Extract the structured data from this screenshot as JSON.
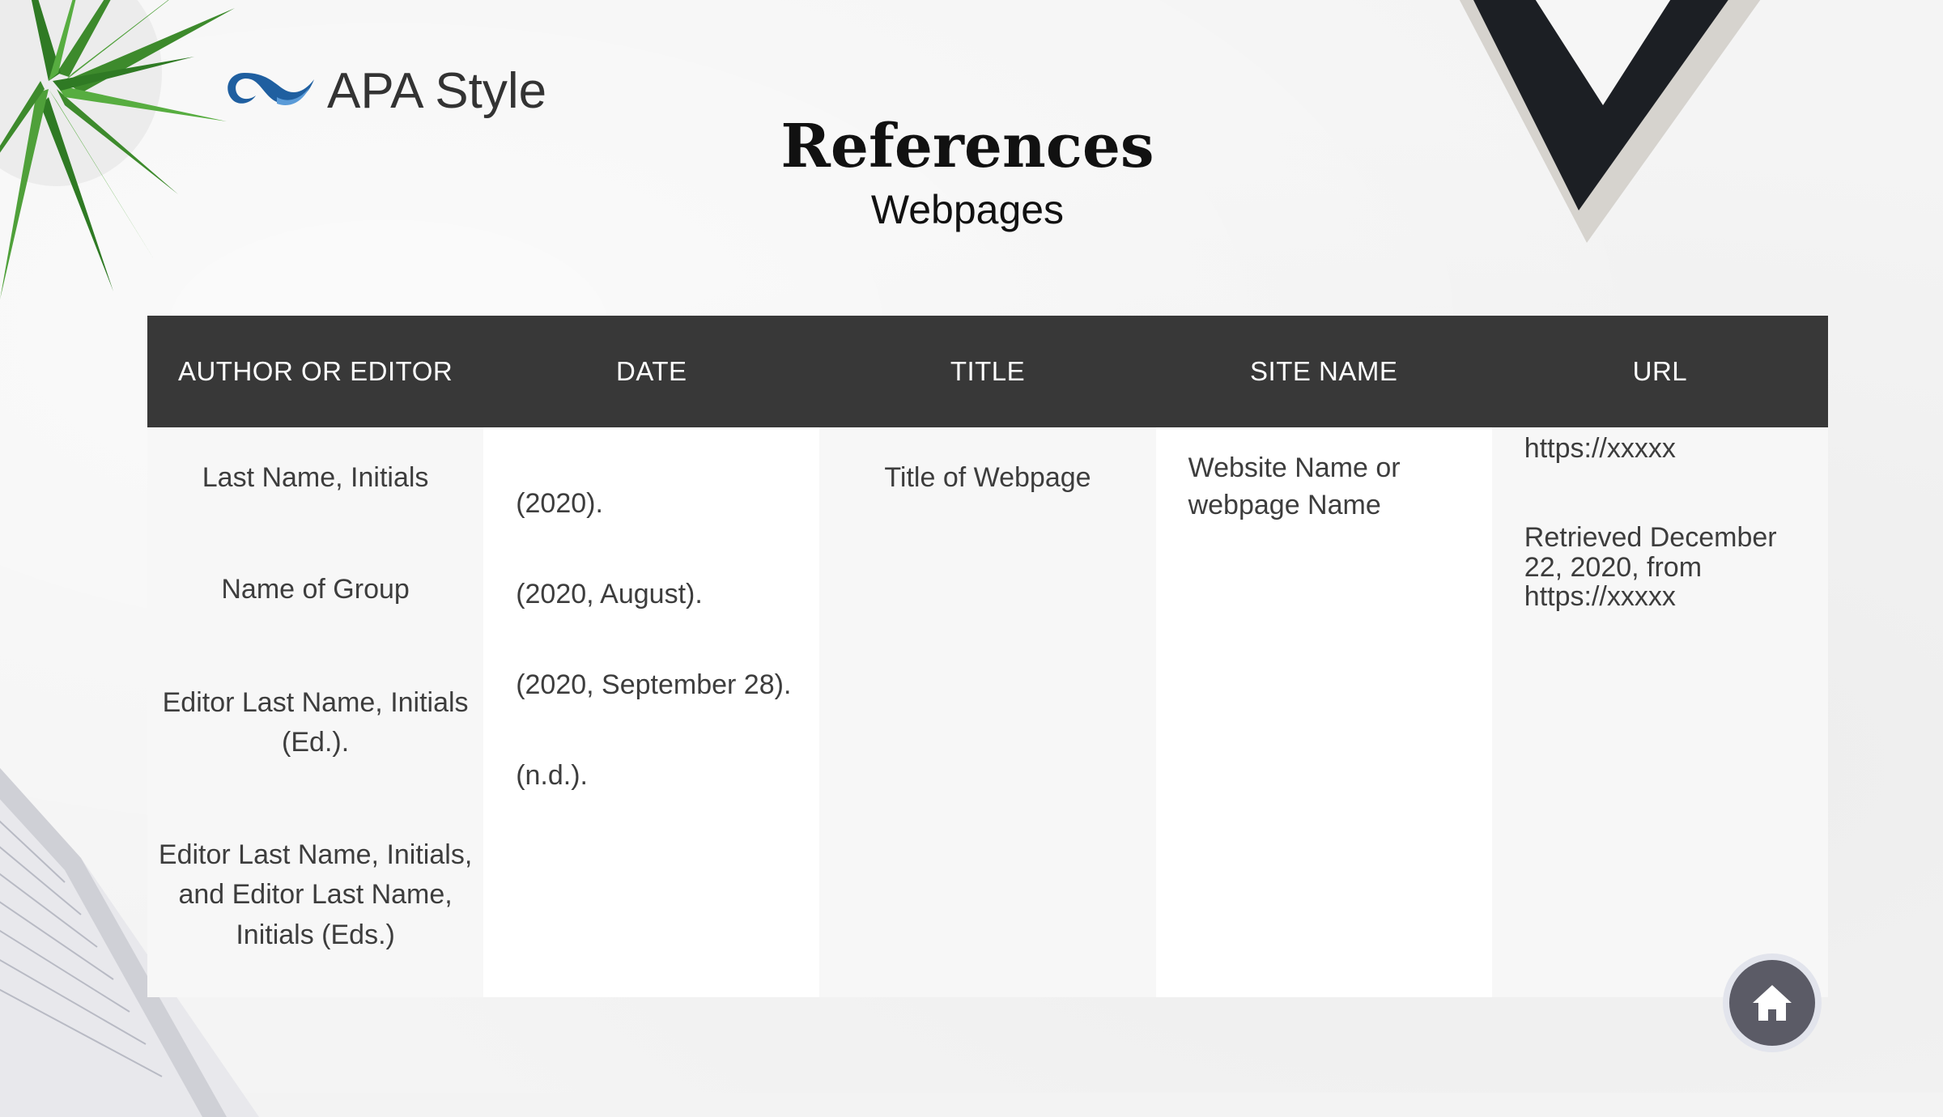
{
  "logo": {
    "text": "APA Style",
    "icon": "apa-wave-icon",
    "accent": "#1f5fa0"
  },
  "header": {
    "title": "References",
    "subtitle": "Webpages"
  },
  "table": {
    "headers": [
      "AUTHOR OR EDITOR",
      "DATE",
      "TITLE",
      "SITE NAME",
      "URL"
    ],
    "author_cells": [
      "Last Name, Initials",
      "Name of Group",
      "Editor Last Name, Initials (Ed.).",
      "Editor Last Name, Initials, and Editor Last Name, Initials (Eds.)"
    ],
    "date_cells": [
      "(2020).",
      "(2020, August).",
      "(2020, September 28).",
      "(n.d.)."
    ],
    "title_cells": [
      "Title of Webpage"
    ],
    "site_cells": [
      "Website Name or webpage Name"
    ],
    "url_cells": [
      "https://xxxxx",
      "Retrieved December 22, 2020, from https://xxxxx"
    ]
  },
  "nav": {
    "home_icon": "home-icon"
  },
  "colors": {
    "header_bg": "#383838",
    "home_button": "#5b5b66"
  }
}
